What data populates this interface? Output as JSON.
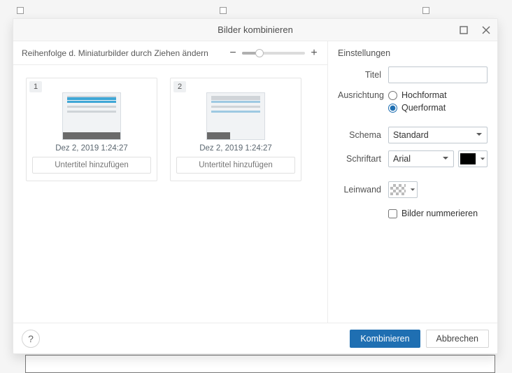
{
  "dialog": {
    "title": "Bilder kombinieren"
  },
  "left": {
    "hint": "Reihenfolge d. Miniaturbilder durch Ziehen ändern",
    "zoom_percent": 28,
    "thumbnails": [
      {
        "index": "1",
        "timestamp": "Dez 2, 2019 1:24:27",
        "caption_placeholder": "Untertitel hinzufügen"
      },
      {
        "index": "2",
        "timestamp": "Dez 2, 2019 1:24:27",
        "caption_placeholder": "Untertitel hinzufügen"
      }
    ]
  },
  "settings": {
    "heading": "Einstellungen",
    "labels": {
      "title": "Titel",
      "orientation": "Ausrichtung",
      "scheme": "Schema",
      "font": "Schriftart",
      "canvas": "Leinwand"
    },
    "title_value": "",
    "orientation": {
      "portrait": "Hochformat",
      "landscape": "Querformat",
      "selected": "landscape"
    },
    "scheme_value": "Standard",
    "font_value": "Arial",
    "font_color": "#000000",
    "canvas_pattern": "checker",
    "number_images_label": "Bilder nummerieren",
    "number_images_checked": false
  },
  "footer": {
    "combine": "Kombinieren",
    "cancel": "Abbrechen"
  }
}
